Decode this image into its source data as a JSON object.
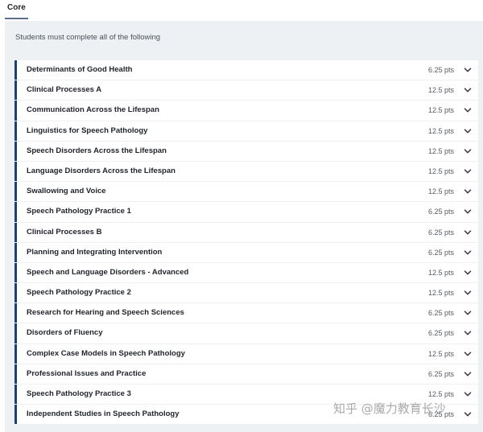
{
  "tabs": [
    {
      "label": "Core",
      "active": true
    }
  ],
  "intro": "Students must complete all of the following",
  "accent_color": "#1f3f74",
  "units": [
    {
      "title": "Determinants of Good Health",
      "points": "6.25 pts"
    },
    {
      "title": "Clinical Processes A",
      "points": "12.5 pts"
    },
    {
      "title": "Communication Across the Lifespan",
      "points": "12.5 pts"
    },
    {
      "title": "Linguistics for Speech Pathology",
      "points": "12.5 pts"
    },
    {
      "title": "Speech Disorders Across the Lifespan",
      "points": "12.5 pts"
    },
    {
      "title": "Language Disorders Across the Lifespan",
      "points": "12.5 pts"
    },
    {
      "title": "Swallowing and Voice",
      "points": "12.5 pts"
    },
    {
      "title": "Speech Pathology Practice 1",
      "points": "6.25 pts"
    },
    {
      "title": "Clinical Processes B",
      "points": "6.25 pts"
    },
    {
      "title": "Planning and Integrating Intervention",
      "points": "6.25 pts"
    },
    {
      "title": "Speech and Language Disorders - Advanced",
      "points": "12.5 pts"
    },
    {
      "title": "Speech Pathology Practice 2",
      "points": "12.5 pts"
    },
    {
      "title": "Research for Hearing and Speech Sciences",
      "points": "6.25 pts"
    },
    {
      "title": "Disorders of Fluency",
      "points": "6.25 pts"
    },
    {
      "title": "Complex Case Models in Speech Pathology",
      "points": "12.5 pts"
    },
    {
      "title": "Professional Issues and Practice",
      "points": "6.25 pts"
    },
    {
      "title": "Speech Pathology Practice 3",
      "points": "12.5 pts"
    },
    {
      "title": "Independent Studies in Speech Pathology",
      "points": "6.25 pts"
    }
  ],
  "chevron_icon": "chevron-down-icon",
  "watermark": "知乎 @魔力教育长沙"
}
